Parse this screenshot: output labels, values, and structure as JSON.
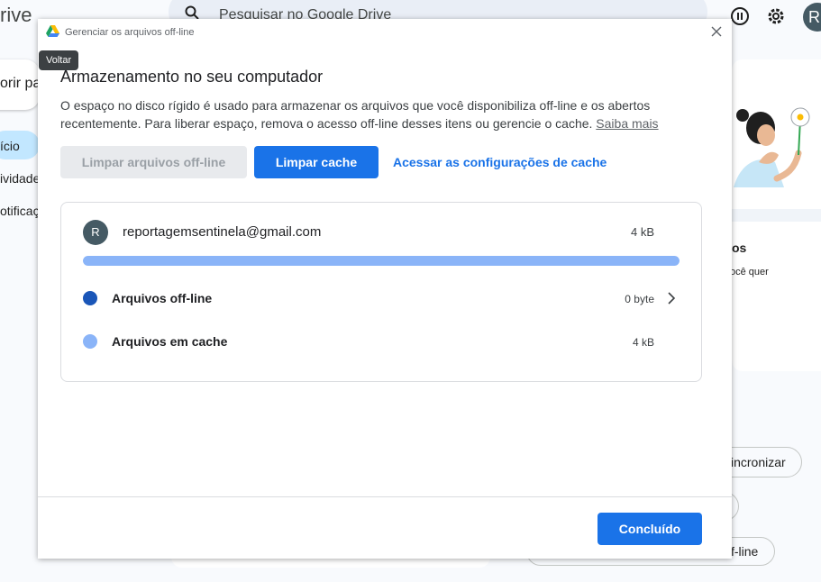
{
  "background": {
    "brand": "rive",
    "search_placeholder": "Pesquisar no Google Drive",
    "avatar_letter": "R",
    "new_label": "orir pa",
    "nav": [
      {
        "label": "ício",
        "active": true
      },
      {
        "label": "ividade",
        "active": false
      },
      {
        "label": "otificaç",
        "active": false
      }
    ],
    "card_title": "os",
    "card_text": "ocê quer",
    "pill_sync": "incronizar",
    "pill_offline": "f-line"
  },
  "dialog": {
    "window_title": "Gerenciar os arquivos off-line",
    "tooltip": "Voltar",
    "heading": "Armazenamento no seu computador",
    "description": "O espaço no disco rígido é usado para armazenar os arquivos que você disponibiliza off-line e os abertos recentemente. Para liberar espaço, remova o acesso off-line desses itens ou gerencie o cache.",
    "learn_more": "Saiba mais",
    "clear_offline_button": "Limpar arquivos off-line",
    "clear_cache_button": "Limpar cache",
    "cache_settings_link": "Acessar as configurações de cache",
    "account": {
      "avatar_letter": "R",
      "email": "reportagemsentinela@gmail.com",
      "total_size": "4 kB",
      "usage_fraction": 1.0,
      "rows": [
        {
          "label": "Arquivos off-line",
          "value": "0 byte",
          "color": "#1a56b8",
          "has_chevron": true
        },
        {
          "label": "Arquivos em cache",
          "value": "4 kB",
          "color": "#8ab4f8",
          "has_chevron": false
        }
      ]
    },
    "done_button": "Concluído"
  },
  "colors": {
    "primary": "#1a73e8",
    "bar": "#8ab4f8",
    "offline_dot": "#1a56b8"
  }
}
